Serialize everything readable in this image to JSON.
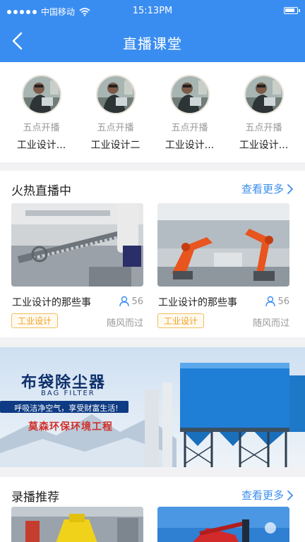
{
  "status": {
    "carrier": "中国移动",
    "time": "15:13PM"
  },
  "header": {
    "title": "直播课堂"
  },
  "teachers": [
    {
      "time": "五点开播",
      "name": "工业设计..."
    },
    {
      "time": "五点开播",
      "name": "工业设计二"
    },
    {
      "time": "五点开播",
      "name": "工业设计..."
    },
    {
      "time": "五点开播",
      "name": "工业设计..."
    }
  ],
  "hot": {
    "title": "火热直播中",
    "more": "查看更多",
    "cards": [
      {
        "title": "工业设计的那些事",
        "viewers": "56",
        "tag": "工业设计",
        "author": "随风而过"
      },
      {
        "title": "工业设计的那些事",
        "viewers": "56",
        "tag": "工业设计",
        "author": "随风而过"
      }
    ]
  },
  "banner": {
    "title": "布袋除尘器",
    "subtitle": "BAG FILTER",
    "slogan": "呼吸洁净空气，享受财富生活!",
    "company": "莫森环保环境工程"
  },
  "recorded": {
    "title": "录播推荐",
    "more": "查看更多"
  }
}
